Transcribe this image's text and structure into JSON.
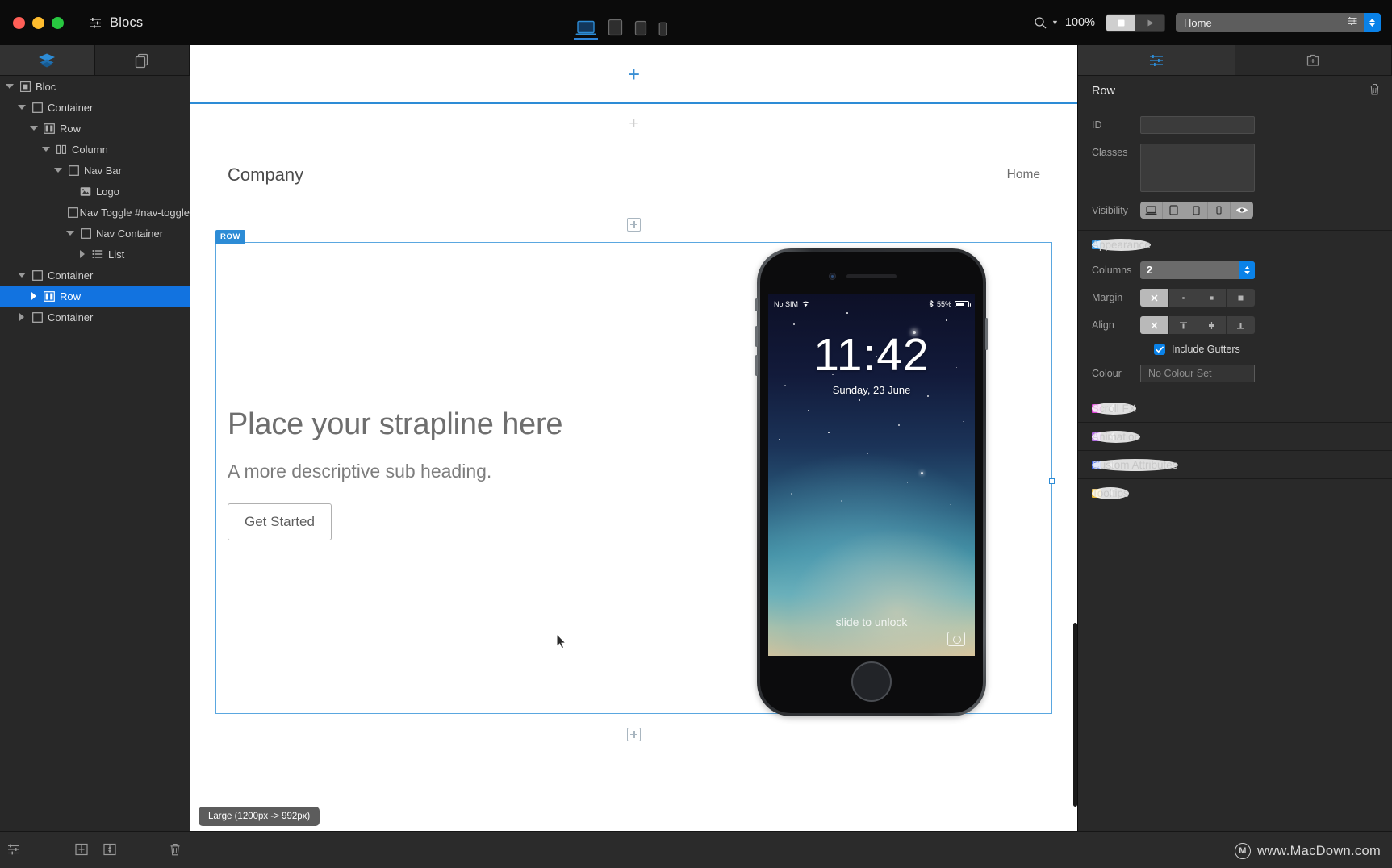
{
  "app": {
    "title": "Blocs",
    "window_buttons": [
      "close",
      "minimize",
      "zoom"
    ]
  },
  "toolbar": {
    "devices": [
      {
        "name": "desktop",
        "label": "Desktop",
        "active": true
      },
      {
        "name": "tablet-landscape",
        "label": "Tablet Landscape",
        "active": false
      },
      {
        "name": "tablet-portrait",
        "label": "Tablet Portrait",
        "active": false
      },
      {
        "name": "mobile",
        "label": "Mobile",
        "active": false
      }
    ],
    "zoom_level": "100%",
    "preview_stop_label": "Stop",
    "preview_play_label": "Preview",
    "page_name": "Home"
  },
  "sidebar": {
    "tabs": [
      {
        "name": "layers",
        "label": "Layer Tree",
        "active": true
      },
      {
        "name": "pages",
        "label": "Pages",
        "active": false
      }
    ],
    "tree": [
      {
        "label": "Bloc",
        "depth": 0,
        "icon": "bloc-icon",
        "twisty": "down",
        "selected": false
      },
      {
        "label": "Container",
        "depth": 1,
        "icon": "container-icon",
        "twisty": "down",
        "selected": false
      },
      {
        "label": "Row",
        "depth": 2,
        "icon": "row-icon",
        "twisty": "down",
        "selected": false
      },
      {
        "label": "Column",
        "depth": 3,
        "icon": "column-icon",
        "twisty": "down",
        "selected": false
      },
      {
        "label": "Nav Bar",
        "depth": 4,
        "icon": "container-icon",
        "twisty": "down",
        "selected": false
      },
      {
        "label": "Logo",
        "depth": 5,
        "icon": "image-icon",
        "twisty": "none",
        "selected": false
      },
      {
        "label": "Nav Toggle #nav-toggle",
        "depth": 5,
        "icon": "container-icon",
        "twisty": "none",
        "selected": false
      },
      {
        "label": "Nav Container",
        "depth": 5,
        "icon": "container-icon",
        "twisty": "down",
        "selected": false
      },
      {
        "label": "List",
        "depth": 6,
        "icon": "list-icon",
        "twisty": "right",
        "selected": false
      },
      {
        "label": "Container",
        "depth": 1,
        "icon": "container-icon",
        "twisty": "down",
        "selected": false
      },
      {
        "label": "Row",
        "depth": 2,
        "icon": "row-icon",
        "twisty": "right",
        "selected": true
      },
      {
        "label": "Container",
        "depth": 1,
        "icon": "container-icon",
        "twisty": "right",
        "selected": false
      }
    ]
  },
  "inspector": {
    "tabs": [
      {
        "name": "settings",
        "label": "Settings",
        "active": true
      },
      {
        "name": "add",
        "label": "Add",
        "active": false
      }
    ],
    "title": "Row",
    "delete_label": "Delete",
    "fields": {
      "id_label": "ID",
      "id_value": "",
      "classes_label": "Classes",
      "classes_value": "",
      "visibility_label": "Visibility",
      "visibility_options": [
        "desktop",
        "tablet-landscape",
        "tablet-portrait",
        "mobile",
        "visible-eye"
      ]
    },
    "appearance": {
      "title": "Appearance",
      "colour": "#2d8cd6",
      "columns_label": "Columns",
      "columns_value": "2",
      "margin_label": "Margin",
      "margin_options": [
        "none",
        "small",
        "medium",
        "large"
      ],
      "margin_selected": 0,
      "align_label": "Align",
      "align_options": [
        "none",
        "top",
        "middle",
        "bottom"
      ],
      "align_selected": 0,
      "gutters_label": "Include Gutters",
      "gutters_checked": true,
      "colour_label": "Colour",
      "colour_value": "No Colour Set"
    },
    "sections": [
      {
        "label": "Scroll FX",
        "colour": "#e040d8"
      },
      {
        "label": "Animation",
        "colour": "#b06ce0"
      },
      {
        "label": "Custom Attributes",
        "colour": "#3a5fe0"
      },
      {
        "label": "Tooltips",
        "colour": "#e8b93a"
      }
    ]
  },
  "canvas": {
    "nav": {
      "brand": "Company",
      "link": "Home"
    },
    "row_badge": "ROW",
    "hero": {
      "heading": "Place your strapline here",
      "subheading": "A more descriptive sub heading.",
      "button": "Get Started"
    },
    "phone": {
      "carrier": "No SIM",
      "battery_percent": "55%",
      "time": "11:42",
      "date": "Sunday, 23 June",
      "unlock_text": "slide to unlock"
    },
    "breakpoint_badge": "Large (1200px -> 992px)"
  },
  "bottom_bar": {
    "icons": [
      "settings-icon",
      "layout-icon",
      "spacing-icon",
      "trash-icon"
    ],
    "watermark": "www.MacDown.com"
  },
  "colors": {
    "accent_blue": "#2d8cd6",
    "selection_blue": "#1273e0",
    "panel_dark": "#292929",
    "canvas_white": "#ffffff"
  }
}
